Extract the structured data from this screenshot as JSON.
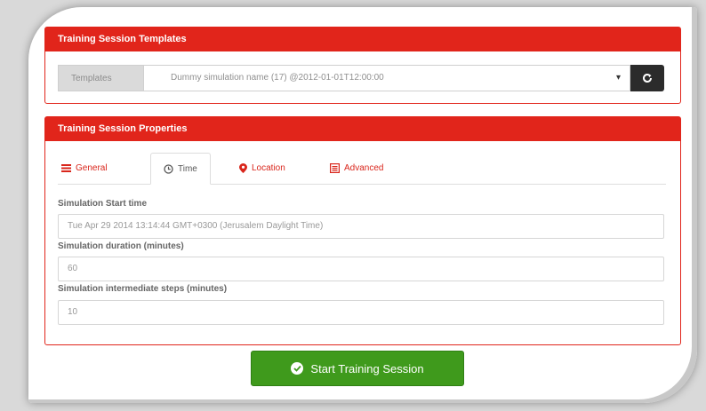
{
  "templates_panel": {
    "title": "Training Session Templates",
    "addon_label": "Templates",
    "selected_template": "Dummy simulation name (17) @2012-01-01T12:00:00",
    "refresh_icon": "refresh-icon"
  },
  "properties_panel": {
    "title": "Training Session Properties",
    "tabs": [
      {
        "label": "General",
        "icon": "list-icon"
      },
      {
        "label": "Time",
        "icon": "clock-icon"
      },
      {
        "label": "Location",
        "icon": "map-marker-icon"
      },
      {
        "label": "Advanced",
        "icon": "table-icon"
      }
    ],
    "active_tab": "Time",
    "fields": {
      "start_time": {
        "label": "Simulation Start time",
        "value": "Tue Apr 29 2014 13:14:44 GMT+0300 (Jerusalem Daylight Time)"
      },
      "duration": {
        "label": "Simulation duration (minutes)",
        "value": "60"
      },
      "steps": {
        "label": "Simulation intermediate steps (minutes)",
        "value": "10"
      }
    }
  },
  "start_button": {
    "label": "Start Training Session",
    "icon": "check-circle-icon"
  },
  "colors": {
    "header_red": "#e1251b",
    "button_green": "#3f9a1c",
    "dark_button": "#2b2b2b"
  }
}
